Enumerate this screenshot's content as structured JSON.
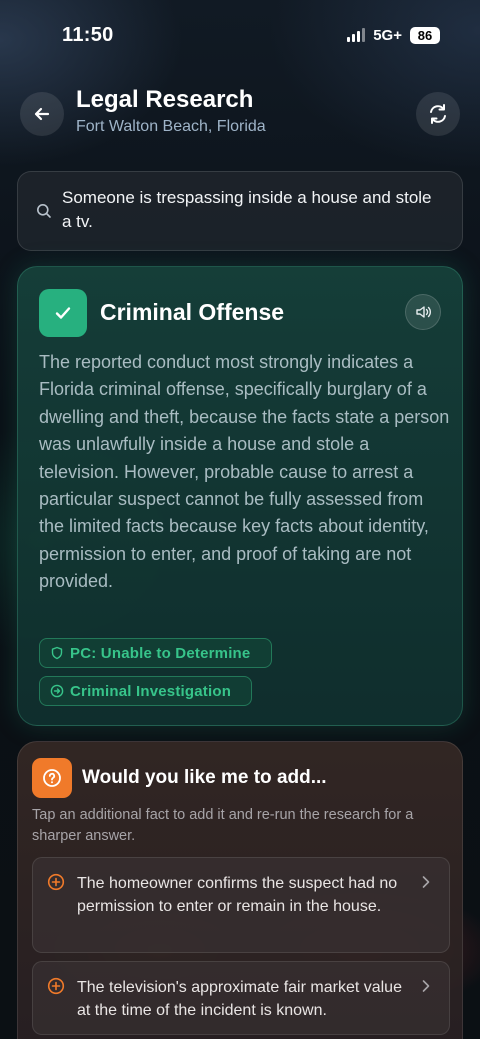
{
  "status_bar": {
    "time": "11:50",
    "network": "5G+",
    "battery": "86"
  },
  "header": {
    "title": "Legal Research",
    "subtitle": "Fort Walton Beach, Florida",
    "back_icon": "arrow-left-icon",
    "refresh_icon": "refresh-icon"
  },
  "search": {
    "query": "Someone is trespassing inside a house and stole a tv.",
    "icon": "search-icon"
  },
  "result": {
    "title": "Criminal Offense",
    "body": "The reported conduct most strongly indicates a Florida criminal offense, specifically burglary of a dwelling and theft, because the facts state a person was unlawfully inside a house and stole a television. However, probable cause to arrest a particular suspect cannot be fully assessed from the limited facts because key facts about identity, permission to enter, and proof of taking are not provided.",
    "tags": [
      {
        "label": "PC: Unable to Determine",
        "icon": "shield-icon"
      },
      {
        "label": "Criminal Investigation",
        "icon": "arrow-circle-icon"
      }
    ],
    "accent_color": "#27b07f"
  },
  "suggestions": {
    "title": "Would you like me to add...",
    "description": "Tap an additional fact to add it and re-run the research for a sharper answer.",
    "accent_color": "#f07a2a",
    "options": [
      {
        "text": "The homeowner confirms the suspect had no permission to enter or remain in the house."
      },
      {
        "text": "The television's approximate fair market value at the time of the incident is known."
      }
    ]
  }
}
